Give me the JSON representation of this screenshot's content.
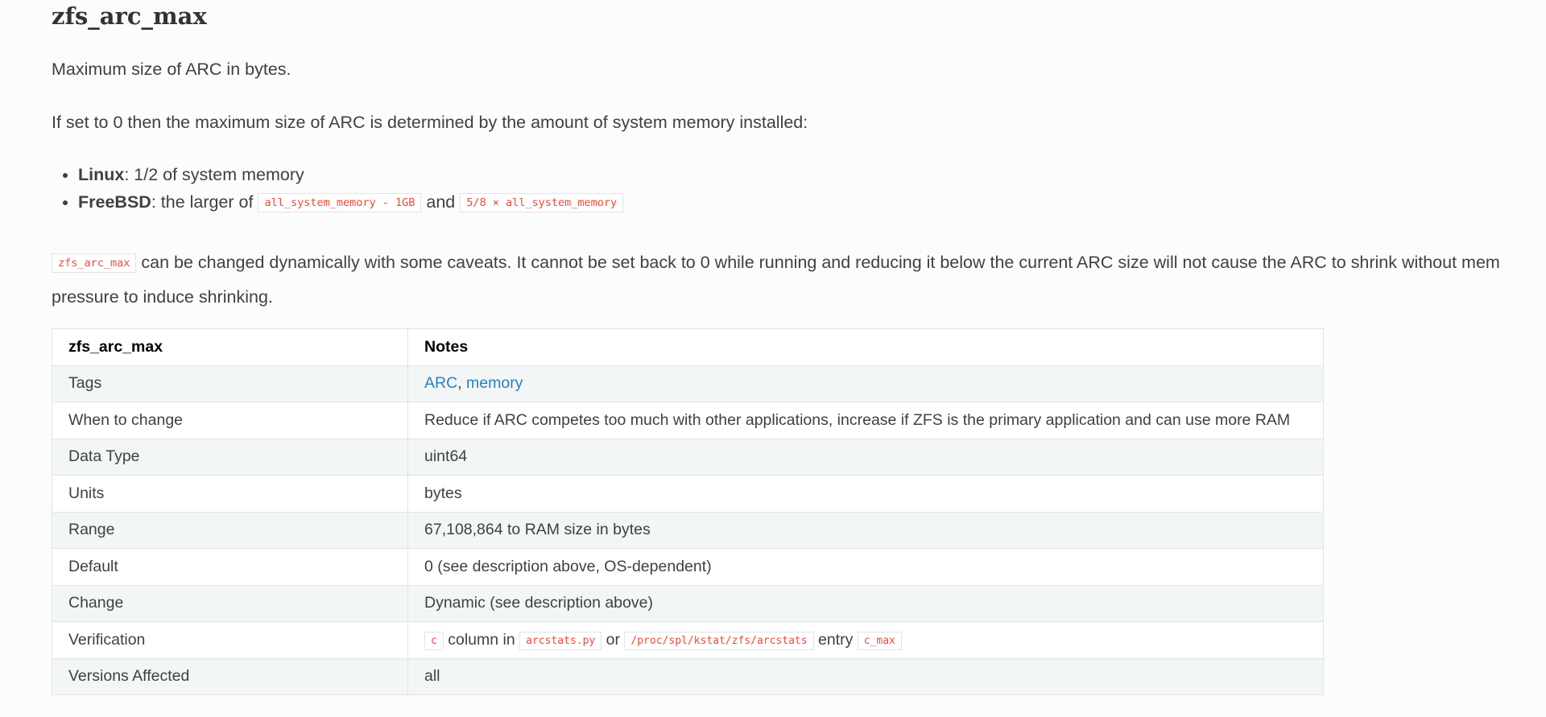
{
  "title": "zfs_arc_max",
  "paragraphs": {
    "p1": "Maximum size of ARC in bytes.",
    "p2": "If set to 0 then the maximum size of ARC is determined by the amount of system memory installed:"
  },
  "bullets": {
    "linux": {
      "label": "Linux",
      "text": ": 1/2 of system memory"
    },
    "freebsd": {
      "label": "FreeBSD",
      "text_before": ": the larger of ",
      "code1": "all_system_memory - 1GB",
      "text_mid": " and ",
      "code2": "5/8 × all_system_memory"
    }
  },
  "caveat": {
    "code": "zfs_arc_max",
    "text_line1": " can be changed dynamically with some caveats. It cannot be set back to 0 while running and reducing it below the current ARC size will not cause the ARC to shrink without mem",
    "text_line2": "pressure to induce shrinking."
  },
  "table": {
    "headers": [
      "zfs_arc_max",
      "Notes"
    ],
    "rows": {
      "tags": {
        "label": "Tags",
        "link1": "ARC",
        "sep": ", ",
        "link2": "memory"
      },
      "when": {
        "label": "When to change",
        "value": "Reduce if ARC competes too much with other applications, increase if ZFS is the primary application and can use more RAM"
      },
      "datatype": {
        "label": "Data Type",
        "value": "uint64"
      },
      "units": {
        "label": "Units",
        "value": "bytes"
      },
      "range": {
        "label": "Range",
        "value": "67,108,864 to RAM size in bytes"
      },
      "default": {
        "label": "Default",
        "value": "0 (see description above, OS-dependent)"
      },
      "change": {
        "label": "Change",
        "value": "Dynamic (see description above)"
      },
      "verification": {
        "label": "Verification",
        "code1": "c",
        "text1": " column in ",
        "code2": "arcstats.py",
        "text2": " or ",
        "code3": "/proc/spl/kstat/zfs/arcstats",
        "text3": " entry ",
        "code4": "c_max"
      },
      "versions": {
        "label": "Versions Affected",
        "value": "all"
      }
    }
  },
  "colors": {
    "link": "#2980b9",
    "code_text": "#e74c3c",
    "row_stripe": "#f3f6f6",
    "border": "#e1e4e5"
  }
}
